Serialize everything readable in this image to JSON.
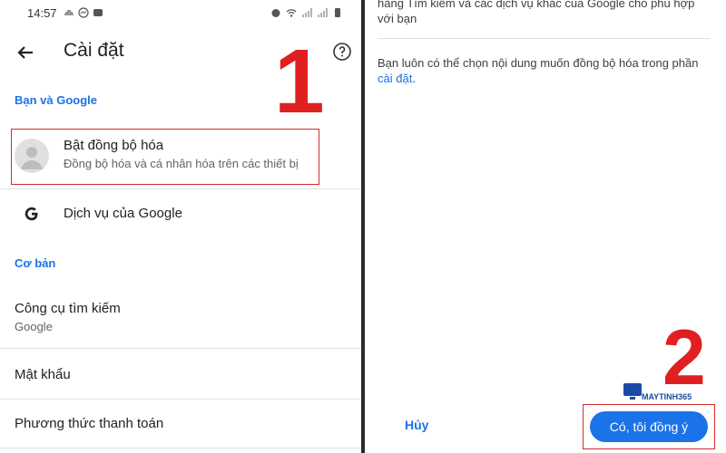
{
  "left": {
    "status_bar": {
      "time": "14:57"
    },
    "app_bar": {
      "title": "Cài đặt"
    },
    "sections": {
      "you_and_google": "Bạn và Google",
      "basics": "Cơ bản"
    },
    "items": {
      "sync": {
        "title": "Bật đồng bộ hóa",
        "subtitle": "Đồng bộ hóa và cá nhân hóa trên các thiết bị"
      },
      "google_services": {
        "title": "Dịch vụ của Google"
      },
      "search_engine": {
        "title": "Công cụ tìm kiếm",
        "subtitle": "Google"
      },
      "passwords": {
        "title": "Mật khẩu"
      },
      "payment_methods": {
        "title": "Phương thức thanh toán"
      }
    },
    "step_number": "1"
  },
  "right": {
    "top_text_line1": "hàng Tìm kiếm và các dịch vụ khác của Google cho phù hợp",
    "top_text_line2": "với bạn",
    "info_text": "Bạn luôn có thể chọn nội dung muốn đồng bộ hóa trong phần",
    "info_link": "cài đặt",
    "info_end": ".",
    "cancel_label": "Hủy",
    "accept_label": "Có, tôi đồng ý",
    "step_number": "2",
    "watermark": "MAYTINH365"
  },
  "colors": {
    "accent": "#1a73e8",
    "highlight": "#d42c2c",
    "step_number": "#e02020"
  }
}
